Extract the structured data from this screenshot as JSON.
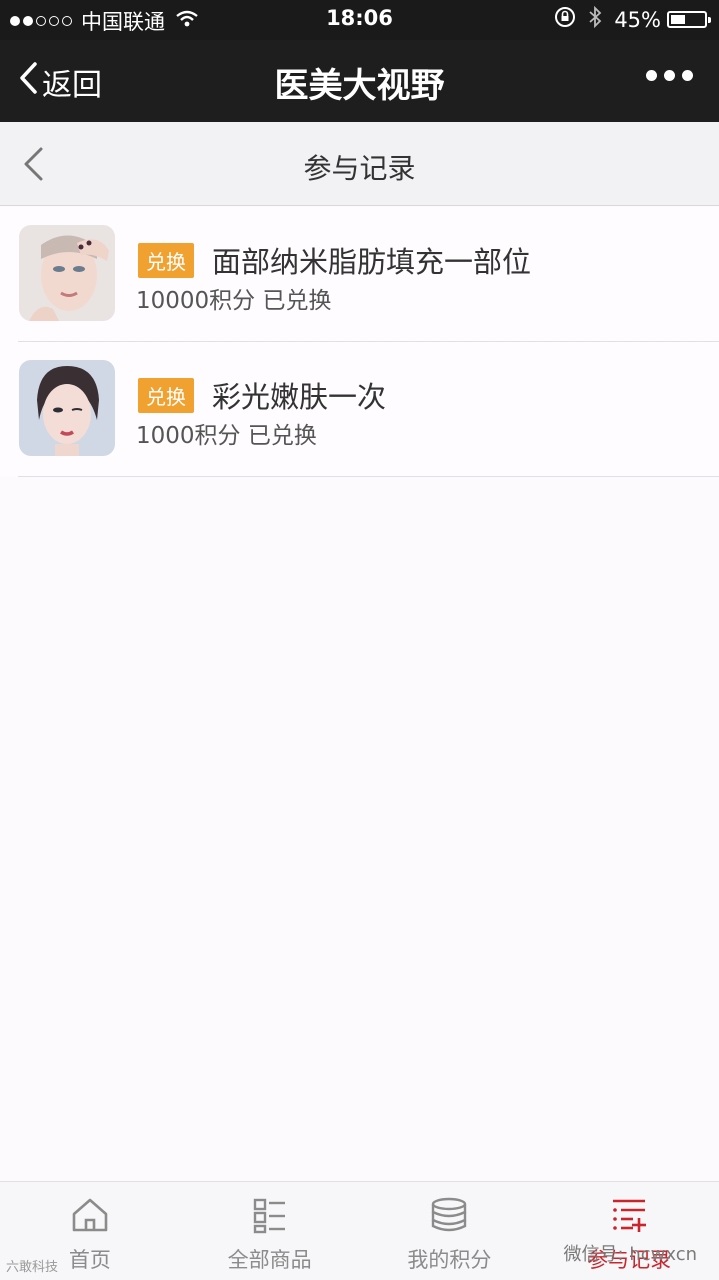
{
  "status_bar": {
    "signal_full": 2,
    "signal_total": 5,
    "carrier": "中国联通",
    "time": "18:06",
    "battery": "45%",
    "icons": [
      "wifi-icon",
      "rotation-lock-icon",
      "bluetooth-icon",
      "battery-icon"
    ]
  },
  "nav": {
    "back_label": "返回",
    "title": "医美大视野",
    "more_icon": "more-dots-icon"
  },
  "subheader": {
    "title": "参与记录"
  },
  "records": [
    {
      "tag": "兑换",
      "name": "面部纳米脂肪填充一部位",
      "meta": "10000积分 已兑换",
      "thumb": "woman-face-hand-photo"
    },
    {
      "tag": "兑换",
      "name": "彩光嫩肤一次",
      "meta": "1000积分 已兑换",
      "thumb": "woman-portrait-photo"
    }
  ],
  "tabbar": {
    "items": [
      {
        "label": "首页",
        "icon": "home-icon",
        "active": false
      },
      {
        "label": "全部商品",
        "icon": "grid-list-icon",
        "active": false
      },
      {
        "label": "我的积分",
        "icon": "coins-stack-icon",
        "active": false
      },
      {
        "label": "参与记录",
        "icon": "record-list-icon",
        "active": true
      }
    ]
  },
  "watermarks": {
    "left": "六敢科技",
    "right": "微信号: hcwxcn"
  },
  "colors": {
    "nav_bg": "#1f1e1f",
    "tag_bg": "#f1a12f",
    "active_tab": "#c9252d"
  }
}
